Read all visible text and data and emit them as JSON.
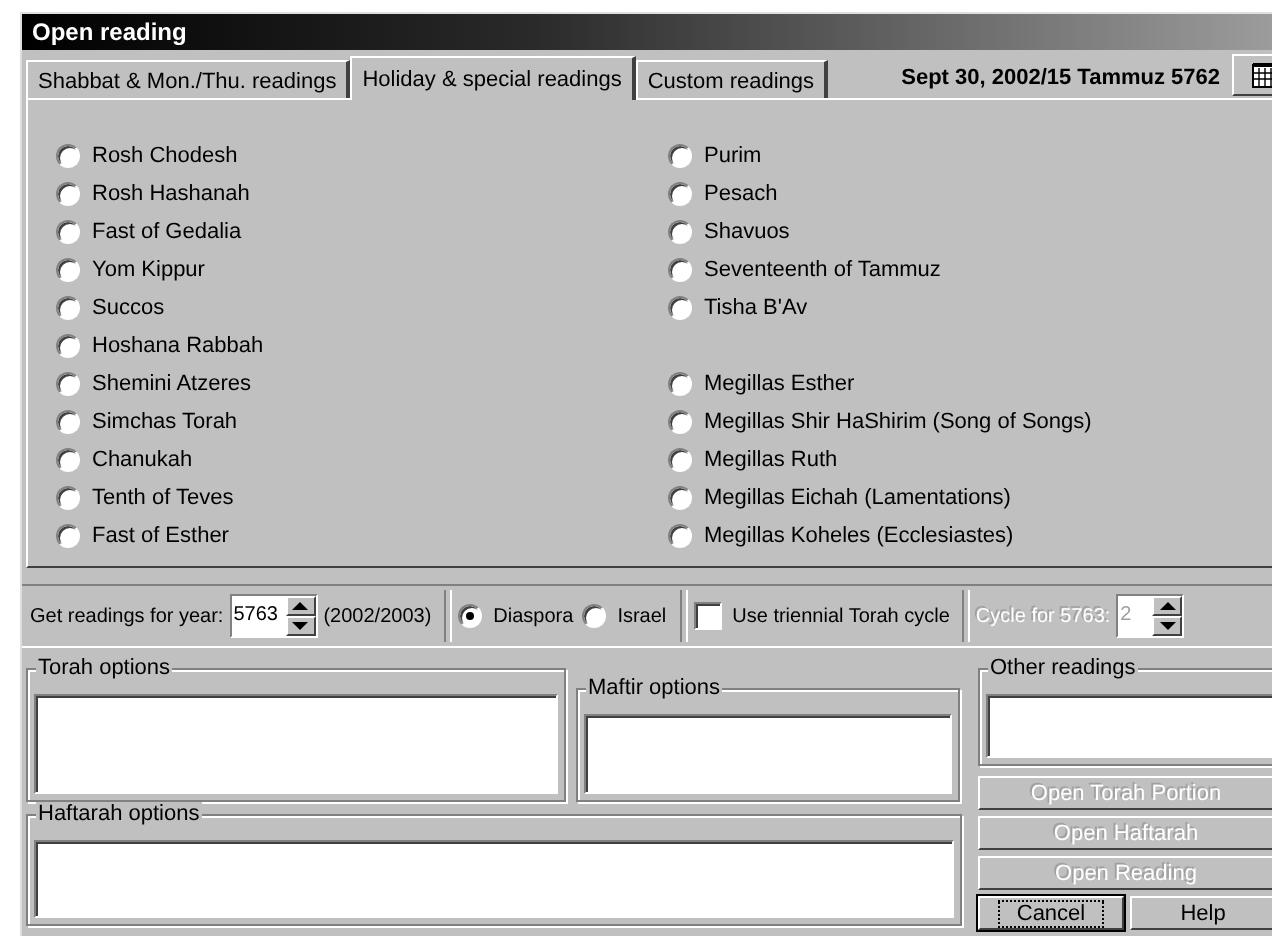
{
  "window": {
    "title": "Open reading"
  },
  "tabs": [
    {
      "label": "Shabbat & Mon./Thu. readings",
      "selected": false
    },
    {
      "label": "Holiday & special readings",
      "selected": true
    },
    {
      "label": "Custom readings",
      "selected": false
    }
  ],
  "date": "Sept 30, 2002/15 Tammuz 5762",
  "holidays": {
    "left": [
      {
        "label": "Rosh Chodesh",
        "selected": false
      },
      {
        "label": "Rosh Hashanah",
        "selected": false
      },
      {
        "label": "Fast of Gedalia",
        "selected": false
      },
      {
        "label": "Yom Kippur",
        "selected": false
      },
      {
        "label": "Succos",
        "selected": false
      },
      {
        "label": "Hoshana Rabbah",
        "selected": false
      },
      {
        "label": "Shemini Atzeres",
        "selected": false
      },
      {
        "label": "Simchas Torah",
        "selected": false
      },
      {
        "label": "Chanukah",
        "selected": false
      },
      {
        "label": "Tenth of Teves",
        "selected": false
      },
      {
        "label": "Fast of Esther",
        "selected": false
      }
    ],
    "right_groups": [
      [
        {
          "label": "Purim",
          "selected": false
        },
        {
          "label": "Pesach",
          "selected": false
        },
        {
          "label": "Shavuos",
          "selected": false
        },
        {
          "label": "Seventeenth of Tammuz",
          "selected": false
        },
        {
          "label": "Tisha B'Av",
          "selected": false
        }
      ],
      [
        {
          "label": "Megillas Esther",
          "selected": false
        },
        {
          "label": "Megillas Shir HaShirim (Song of Songs)",
          "selected": false
        },
        {
          "label": "Megillas Ruth",
          "selected": false
        },
        {
          "label": "Megillas Eichah (Lamentations)",
          "selected": false
        },
        {
          "label": "Megillas Koheles (Ecclesiastes)",
          "selected": false
        }
      ]
    ]
  },
  "year_row": {
    "label": "Get readings for year:",
    "year": "5763",
    "range": "(2002/2003)",
    "locations": [
      {
        "label": "Diaspora",
        "selected": true
      },
      {
        "label": "Israel",
        "selected": false
      }
    ],
    "triennial": {
      "label": "Use triennial Torah cycle",
      "checked": false
    },
    "cycle": {
      "label": "Cycle for 5763:",
      "value": "2",
      "disabled": true
    }
  },
  "groups": [
    {
      "kind": "torah",
      "title": "Torah options"
    },
    {
      "kind": "maftir",
      "title": "Maftir options"
    },
    {
      "kind": "other",
      "title": "Other readings"
    },
    {
      "kind": "haftarah",
      "title": "Haftarah options"
    }
  ],
  "buttons": [
    {
      "label": "Open Torah Portion",
      "disabled": true,
      "focused": false
    },
    {
      "label": "Open Haftarah",
      "disabled": true,
      "focused": false
    },
    {
      "label": "Open Reading",
      "disabled": true,
      "focused": false
    },
    {
      "label": "Cancel",
      "disabled": false,
      "focused": true
    },
    {
      "label": "Help",
      "disabled": false,
      "focused": false
    }
  ]
}
